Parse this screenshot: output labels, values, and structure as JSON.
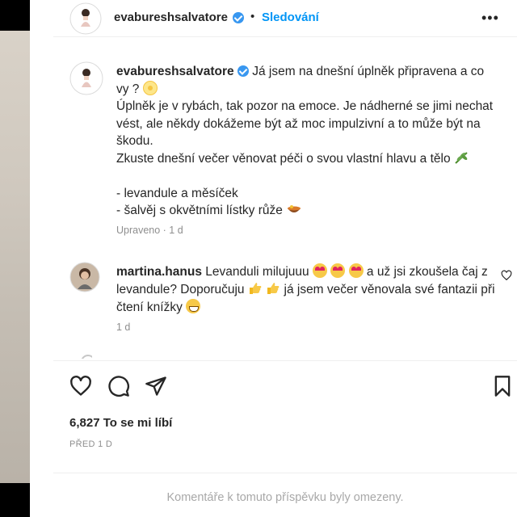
{
  "header": {
    "username": "evabureshsalvatore",
    "dot": "•",
    "follow_label": "Sledování",
    "more_label": "•••"
  },
  "caption": {
    "username": "evabureshsalvatore",
    "line1": "Já jsem na dnešní úplněk připravena a co vy ?",
    "line2": "Úplněk je v rybách, tak pozor na emoce. Je nádherné se jimi nechat vést, ale někdy dokážeme být až moc impulzivní a to může být na škodu.",
    "line3": "Zkuste dnešní večer věnovat péči o svou vlastní hlavu a tělo",
    "item1": "- levandule a měsíček",
    "item2": "- šalvěj s okvětními lístky růže",
    "meta": "Upraveno · 1 d"
  },
  "comment": {
    "username": "martina.hanus",
    "part1": "Levanduli milujuuu",
    "part2": "a už jsi zkoušela čaj z levandule? Doporučuju",
    "part3": "já jsem večer věnovala své fantazii při čtení knížky",
    "meta": "1 d"
  },
  "likes": "6,827 To se mi líbí",
  "date": "PŘED 1 D",
  "limited": "Komentáře k tomuto příspěvku byly omezeny.",
  "icons": {
    "verified": "verified-badge-icon",
    "like": "heart-icon",
    "comment": "comment-bubble-icon",
    "share": "paper-plane-icon",
    "save": "bookmark-icon"
  },
  "colors": {
    "follow": "#0095f6",
    "verified": "#3897f0",
    "meta": "#8e8e8e"
  }
}
